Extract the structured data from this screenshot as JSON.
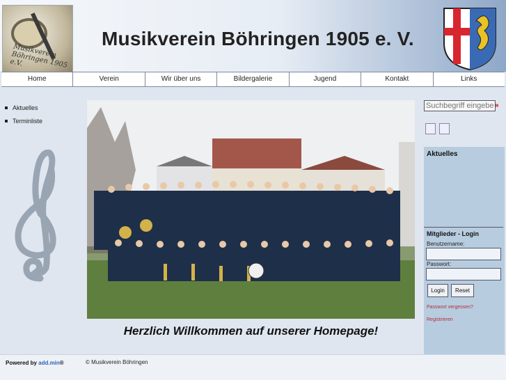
{
  "header": {
    "title": "Musikverein Böhringen 1905 e. V.",
    "logo_text": "Musikverein Böhringen 1905 e.V."
  },
  "nav": {
    "items": [
      {
        "label": "Home"
      },
      {
        "label": "Verein"
      },
      {
        "label": "Wir über uns"
      },
      {
        "label": "Bildergalerie"
      },
      {
        "label": "Jugend"
      },
      {
        "label": "Kontakt"
      },
      {
        "label": "Links"
      }
    ]
  },
  "sidebar": {
    "items": [
      {
        "label": "Aktuelles"
      },
      {
        "label": "Terminliste"
      }
    ]
  },
  "main": {
    "welcome": "Herzlich Willkommen auf unserer Homepage!"
  },
  "search": {
    "placeholder": "Suchbegriff eingeben",
    "go_icon": "double-arrow-right-icon"
  },
  "tools": {
    "print_icon": "print-icon",
    "email_icon": "email-icon"
  },
  "news_panel": {
    "title": "Aktuelles"
  },
  "login": {
    "title": "Mitglieder - Login",
    "username_label": "Benutzername:",
    "password_label": "Passwort:",
    "login_button": "Login",
    "reset_button": "Reset",
    "forgot_link": "Passwort vergessen?",
    "register_link": "Registrieren"
  },
  "footer": {
    "powered_prefix": "Powered by ",
    "powered_brand": "add.min",
    "powered_suffix": "®",
    "copyright": "© Musikverein Böhringen"
  },
  "colors": {
    "accent": "#2a64b4",
    "link": "#b0303a",
    "panel": "#b8cce0"
  }
}
